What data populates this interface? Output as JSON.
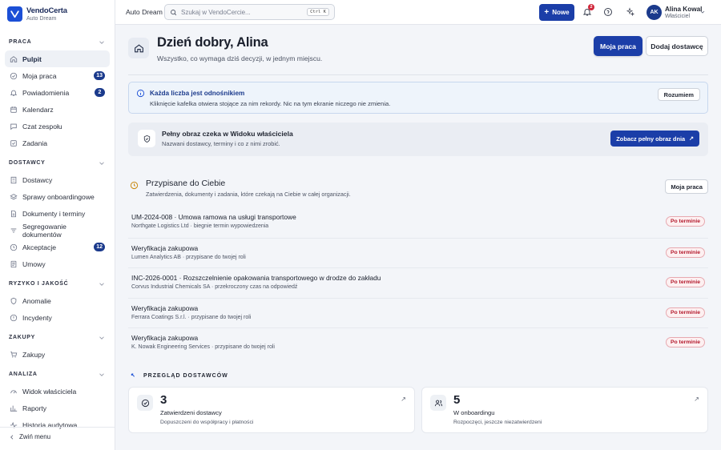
{
  "brand": {
    "name": "VendoCerta",
    "sub": "Auto Dream"
  },
  "sidebar": {
    "sections": [
      {
        "label": "Praca",
        "items": [
          {
            "label": "Pulpit",
            "icon": "home-icon",
            "active": true
          },
          {
            "label": "Moja praca",
            "icon": "check-circle-icon",
            "badge": "13"
          },
          {
            "label": "Powiadomienia",
            "icon": "bell-icon",
            "badge": "2"
          },
          {
            "label": "Kalendarz",
            "icon": "calendar-icon"
          },
          {
            "label": "Czat zespołu",
            "icon": "chat-icon"
          },
          {
            "label": "Zadania",
            "icon": "tasks-icon"
          }
        ]
      },
      {
        "label": "Dostawcy",
        "items": [
          {
            "label": "Dostawcy",
            "icon": "building-icon"
          },
          {
            "label": "Sprawy onboardingowe",
            "icon": "layers-icon"
          },
          {
            "label": "Dokumenty i terminy",
            "icon": "document-icon"
          },
          {
            "label": "Segregowanie dokumentów",
            "icon": "sort-icon"
          },
          {
            "label": "Akceptacje",
            "icon": "clock-icon",
            "badge": "12"
          },
          {
            "label": "Umowy",
            "icon": "contract-icon"
          }
        ]
      },
      {
        "label": "Ryzyko i jakość",
        "items": [
          {
            "label": "Anomalie",
            "icon": "shield-icon"
          },
          {
            "label": "Incydenty",
            "icon": "alert-icon"
          }
        ]
      },
      {
        "label": "Zakupy",
        "items": [
          {
            "label": "Zakupy",
            "icon": "cart-icon"
          }
        ]
      },
      {
        "label": "Analiza",
        "items": [
          {
            "label": "Widok właściciela",
            "icon": "gauge-icon"
          },
          {
            "label": "Raporty",
            "icon": "report-icon"
          },
          {
            "label": "Historia audytowa",
            "icon": "activity-icon"
          }
        ]
      }
    ],
    "collapse_label": "Zwiń menu"
  },
  "topbar": {
    "org": "Auto Dream",
    "search_placeholder": "Szukaj w VendoCercie...",
    "shortcut": "Ctrl K",
    "new_label": "Nowe",
    "notif_count": "2",
    "user": {
      "initials": "AK",
      "name": "Alina Kowal",
      "role": "Właściciel"
    }
  },
  "header": {
    "greeting": "Dzień dobry, Alina",
    "subtitle": "Wszystko, co wymaga dziś decyzji, w jednym miejscu.",
    "primary_btn": "Moja praca",
    "secondary_btn": "Dodaj dostawcę"
  },
  "info": {
    "title": "Każda liczba jest odnośnikiem",
    "body": "Kliknięcie kafelka otwiera stojące za nim rekordy. Nic na tym ekranie niczego nie zmienia.",
    "button": "Rozumiem"
  },
  "owner": {
    "title": "Pełny obraz czeka w Widoku właściciela",
    "subtitle": "Nazwani dostawcy, terminy i co z nimi zrobić.",
    "button": "Zobacz pełny obraz dnia"
  },
  "assigned": {
    "title": "Przypisane do Ciebie",
    "subtitle": "Zatwierdzenia, dokumenty i zadania, które czekają na Ciebie w całej organizacji.",
    "button": "Moja praca",
    "rows": [
      {
        "title": "UM-2024-008 · Umowa ramowa na usługi transportowe",
        "sub": "Northgate Logistics Ltd · biegnie termin wypowiedzenia",
        "status": "Po terminie"
      },
      {
        "title": "Weryfikacja zakupowa",
        "sub": "Lumen Analytics AB · przypisane do twojej roli",
        "status": "Po terminie"
      },
      {
        "title": "INC-2026-0001 · Rozszczelnienie opakowania transportowego w drodze do zakładu",
        "sub": "Corvus Industrial Chemicals SA · przekroczony czas na odpowiedź",
        "status": "Po terminie"
      },
      {
        "title": "Weryfikacja zakupowa",
        "sub": "Ferrara Coatings S.r.l. · przypisane do twojej roli",
        "status": "Po terminie"
      },
      {
        "title": "Weryfikacja zakupowa",
        "sub": "K. Nowak Engineering Services · przypisane do twojej roli",
        "status": "Po terminie"
      }
    ]
  },
  "overview": {
    "title": "Przegląd dostawców",
    "cards": [
      {
        "value": "3",
        "label": "Zatwierdzeni dostawcy",
        "sub": "Dopuszczeni do współpracy i płatności",
        "icon": "check-circle-icon"
      },
      {
        "value": "5",
        "label": "W onboardingu",
        "sub": "Rozpoczęci, jeszcze niezatwierdzeni",
        "icon": "users-icon"
      }
    ]
  },
  "colors": {
    "primary": "#1b3ea8",
    "danger": "#b3182c",
    "info_bg": "#eef4fb"
  }
}
